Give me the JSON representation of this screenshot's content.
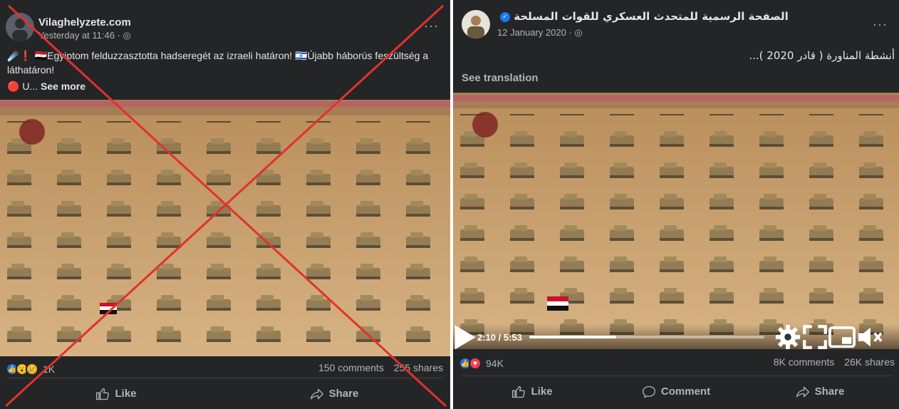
{
  "left": {
    "page_name": "Vilaghelyzete.com",
    "time": "Yesterday at 11:46 · ",
    "more_label": "···",
    "post_text": "☄️❗ 🇪🇬Egyiptom felduzzasztotta hadseregét az izraeli határon! 🇮🇱Újabb háborús feszültség a láthatáron!",
    "post_text2_prefix": "🔴 U... ",
    "see_more": "See more",
    "reactions_count": "1K",
    "comments": "150 comments",
    "shares": "255 shares",
    "like_label": "Like",
    "share_label": "Share"
  },
  "right": {
    "page_name": "الصفحة الرسمية للمتحدث العسكري للقوات المسلحة",
    "time": "12 January 2020 · ",
    "more_label": "···",
    "post_text": "أنشطة المناورة ( قادر 2020 )...",
    "see_translation": "See translation",
    "video_time": "2:10 / 5:53",
    "video_progress": 0.37,
    "reactions_count": "94K",
    "comments": "8K comments",
    "shares": "26K shares",
    "like_label": "Like",
    "comment_label": "Comment",
    "share_label": "Share"
  },
  "colors": {
    "panel_bg": "#242526",
    "accent": "#1877f2",
    "fake_cross": "#e3312c",
    "desert": "#c9a06a"
  },
  "icons": {
    "globe": "globe-icon",
    "like": "thumbs-up-icon",
    "comment": "comment-bubble-icon",
    "share": "share-arrow-icon",
    "play": "play-icon",
    "settings": "gear-icon",
    "fullscreen": "expand-icon",
    "pip": "picture-in-picture-icon",
    "volume": "mute-icon"
  }
}
